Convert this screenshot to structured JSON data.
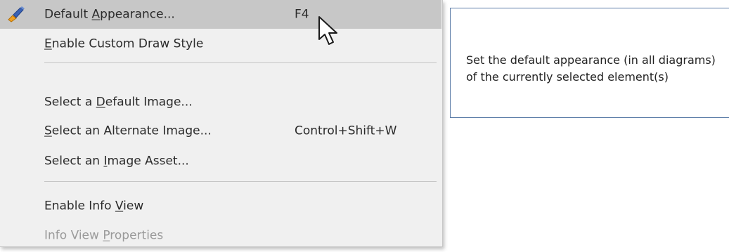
{
  "menu": {
    "items": [
      {
        "label_pre": "Default ",
        "label_ul": "A",
        "label_post": "ppearance...",
        "shortcut": "F4",
        "icon": "paintbrush-icon"
      },
      {
        "label_pre": "",
        "label_ul": "E",
        "label_post": "nable Custom Draw Style"
      },
      {
        "label_pre": "Select a ",
        "label_ul": "D",
        "label_post": "efault Image..."
      },
      {
        "label_pre": "",
        "label_ul": "S",
        "label_post": "elect an Alternate Image...",
        "shortcut": "Control+Shift+W"
      },
      {
        "label_pre": "Select an ",
        "label_ul": "I",
        "label_post": "mage Asset..."
      },
      {
        "label_pre": "Enable Info ",
        "label_ul": "V",
        "label_post": "iew"
      },
      {
        "label_pre": "Info View ",
        "label_ul": "P",
        "label_post": "roperties",
        "state": "disabled"
      }
    ]
  },
  "tooltip": {
    "text": "Set the default appearance (in all diagrams) of the currently selected element(s)"
  },
  "colors": {
    "menu_bg": "#f0f0f0",
    "highlight_bg": "#c7c7c7",
    "disabled_text": "#9a9a9a",
    "tooltip_border": "#5b7ca8"
  }
}
